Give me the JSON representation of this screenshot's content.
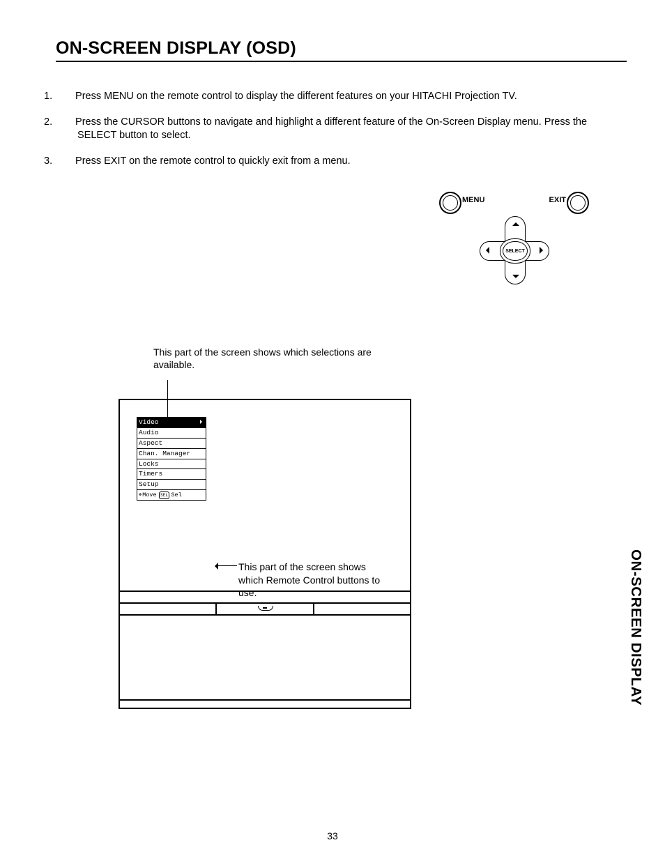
{
  "heading": "ON-SCREEN DISPLAY (OSD)",
  "steps": [
    "Press MENU on the remote control to display the different features on your HITACHI Projection TV.",
    "Press the CURSOR buttons to navigate and highlight a different feature of the On-Screen Display menu. Press the SELECT button to select.",
    "Press EXIT on the remote control to quickly exit from a menu."
  ],
  "remote": {
    "menu": "MENU",
    "exit": "EXIT",
    "select": "SELECT"
  },
  "annotations": {
    "top": "This part of the screen shows which selections are available.",
    "right": "This part of the screen shows which Remote Control buttons to use."
  },
  "menu_items": [
    "Video",
    "Audio",
    "Aspect",
    "Chan. Manager",
    "Locks",
    "Timers",
    "Setup"
  ],
  "menu_selected_index": 0,
  "hint": {
    "move": "Move",
    "sel_btn": "SEL",
    "sel": "Sel"
  },
  "sidetab": "ON-SCREEN DISPLAY",
  "page_number": "33"
}
